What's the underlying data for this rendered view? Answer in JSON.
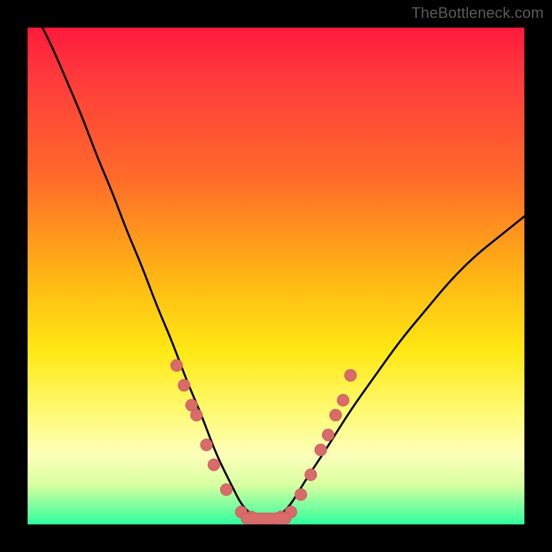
{
  "attribution": "TheBottleneck.com",
  "colors": {
    "curve_stroke": "#000000",
    "marker_fill": "#d96b6b",
    "marker_stroke": "#c85a5a",
    "background_frame": "#000000"
  },
  "chart_data": {
    "type": "line",
    "title": "",
    "xlabel": "",
    "ylabel": "",
    "xlim": [
      0,
      100
    ],
    "ylim": [
      0,
      100
    ],
    "grid": false,
    "legend": false,
    "series": [
      {
        "name": "bottleneck-curve",
        "x": [
          3,
          5,
          8,
          11,
          14,
          17,
          20,
          23,
          26,
          29,
          32,
          35,
          38,
          41,
          43,
          45,
          47,
          49,
          51,
          53,
          56,
          60,
          65,
          70,
          75,
          80,
          85,
          90,
          95,
          100
        ],
        "y": [
          100,
          96,
          89,
          82,
          74,
          67,
          59,
          52,
          44,
          37,
          29,
          22,
          14,
          8,
          4,
          2,
          1,
          1,
          2,
          4,
          9,
          15,
          23,
          30,
          37,
          43,
          49,
          54,
          58,
          62
        ]
      }
    ],
    "markers": [
      {
        "x": 30,
        "y": 32
      },
      {
        "x": 31.5,
        "y": 28
      },
      {
        "x": 33,
        "y": 24
      },
      {
        "x": 34,
        "y": 22
      },
      {
        "x": 36,
        "y": 16
      },
      {
        "x": 37.5,
        "y": 12
      },
      {
        "x": 40,
        "y": 7
      },
      {
        "x": 43,
        "y": 2.5
      },
      {
        "x": 45,
        "y": 1.5
      },
      {
        "x": 47,
        "y": 1
      },
      {
        "x": 49,
        "y": 1
      },
      {
        "x": 51,
        "y": 1.5
      },
      {
        "x": 53,
        "y": 2.5
      },
      {
        "x": 55,
        "y": 6
      },
      {
        "x": 57,
        "y": 10
      },
      {
        "x": 59,
        "y": 15
      },
      {
        "x": 60.5,
        "y": 18
      },
      {
        "x": 62,
        "y": 22
      },
      {
        "x": 63.5,
        "y": 25
      },
      {
        "x": 65,
        "y": 30
      }
    ],
    "trough_bar": {
      "x0": 43,
      "x1": 53,
      "y": 1.2,
      "thickness": 2.2
    }
  }
}
